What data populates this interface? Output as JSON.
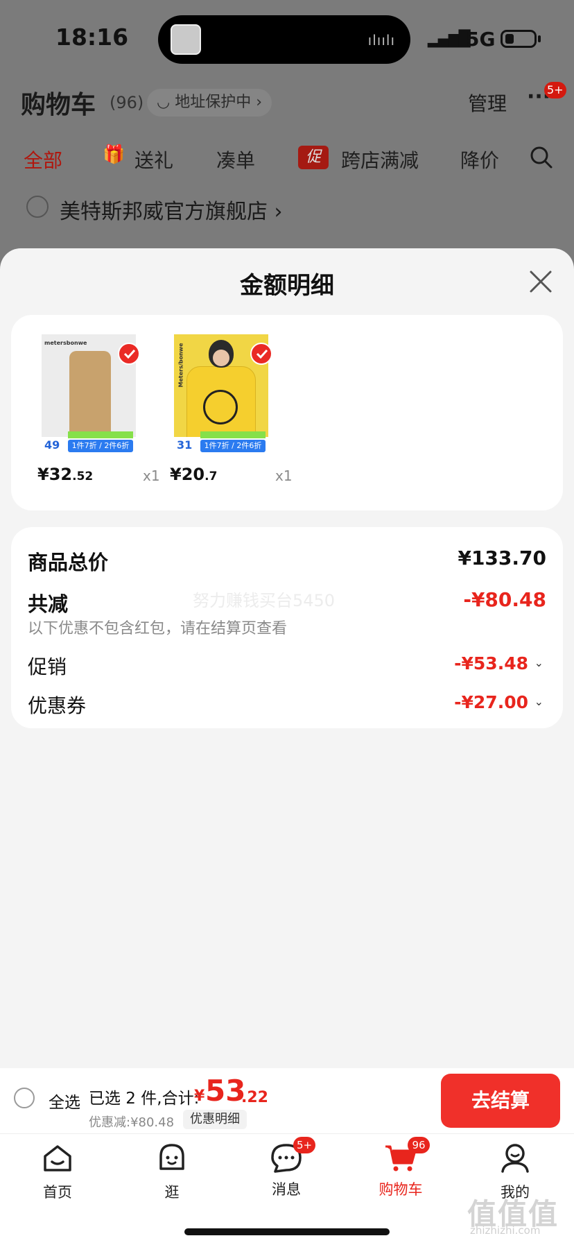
{
  "status_bar": {
    "time": "18:16",
    "network": "5G"
  },
  "cart_header": {
    "title": "购物车",
    "count": "(96)",
    "address_protect": "地址保护中 ›",
    "manage": "管理",
    "more_badge": "5+"
  },
  "filter_tabs": [
    {
      "label": "全部"
    },
    {
      "label": "送礼"
    },
    {
      "label": "凑单"
    },
    {
      "label": "跨店满减"
    },
    {
      "label": "降价"
    }
  ],
  "promo_icon_text": "促",
  "store": {
    "name": "美特斯邦威官方旗舰店 ›"
  },
  "sheet": {
    "title": "金额明细",
    "products": [
      {
        "brand": "metersbonwe",
        "tag_price": "49",
        "offer": "1件7折 / 2件6折",
        "price_int": "¥32",
        "price_dec": ".52",
        "qty": "x1"
      },
      {
        "brand": "Meters/bonwe",
        "tag_price": "31",
        "offer": "1件7折 / 2件6折",
        "price_int": "¥20",
        "price_dec": ".7",
        "qty": "x1"
      }
    ],
    "summary": {
      "total_label": "商品总价",
      "total_value": "¥133.70",
      "reduce_label": "共减",
      "reduce_value": "-¥80.48",
      "note": "以下优惠不包含红包，请在结算页查看",
      "promo_label": "促销",
      "promo_value": "-¥53.48",
      "coupon_label": "优惠券",
      "coupon_value": "-¥27.00",
      "watermark": "努力赚钱买台5450"
    }
  },
  "checkout": {
    "select_all": "全选",
    "selected": "已选 2 件,合计:",
    "yen": "¥",
    "total_int": "53",
    "total_dec": ".22",
    "discount": "优惠减:¥80.48",
    "detail_link": "优惠明细",
    "pay_button": "去结算"
  },
  "tab_bar": [
    {
      "label": "首页",
      "icon": "home-icon"
    },
    {
      "label": "逛",
      "icon": "face-icon"
    },
    {
      "label": "消息",
      "icon": "message-icon",
      "badge": "5+"
    },
    {
      "label": "购物车",
      "icon": "cart-icon",
      "badge": "96"
    },
    {
      "label": "我的",
      "icon": "profile-icon"
    }
  ],
  "site_watermark": {
    "mark": "值值值",
    "url": "zhizhizhi.com"
  },
  "colors": {
    "accent": "#e8251d",
    "pay_button": "#f0302a",
    "sheet_bg": "#f4f4f4"
  }
}
